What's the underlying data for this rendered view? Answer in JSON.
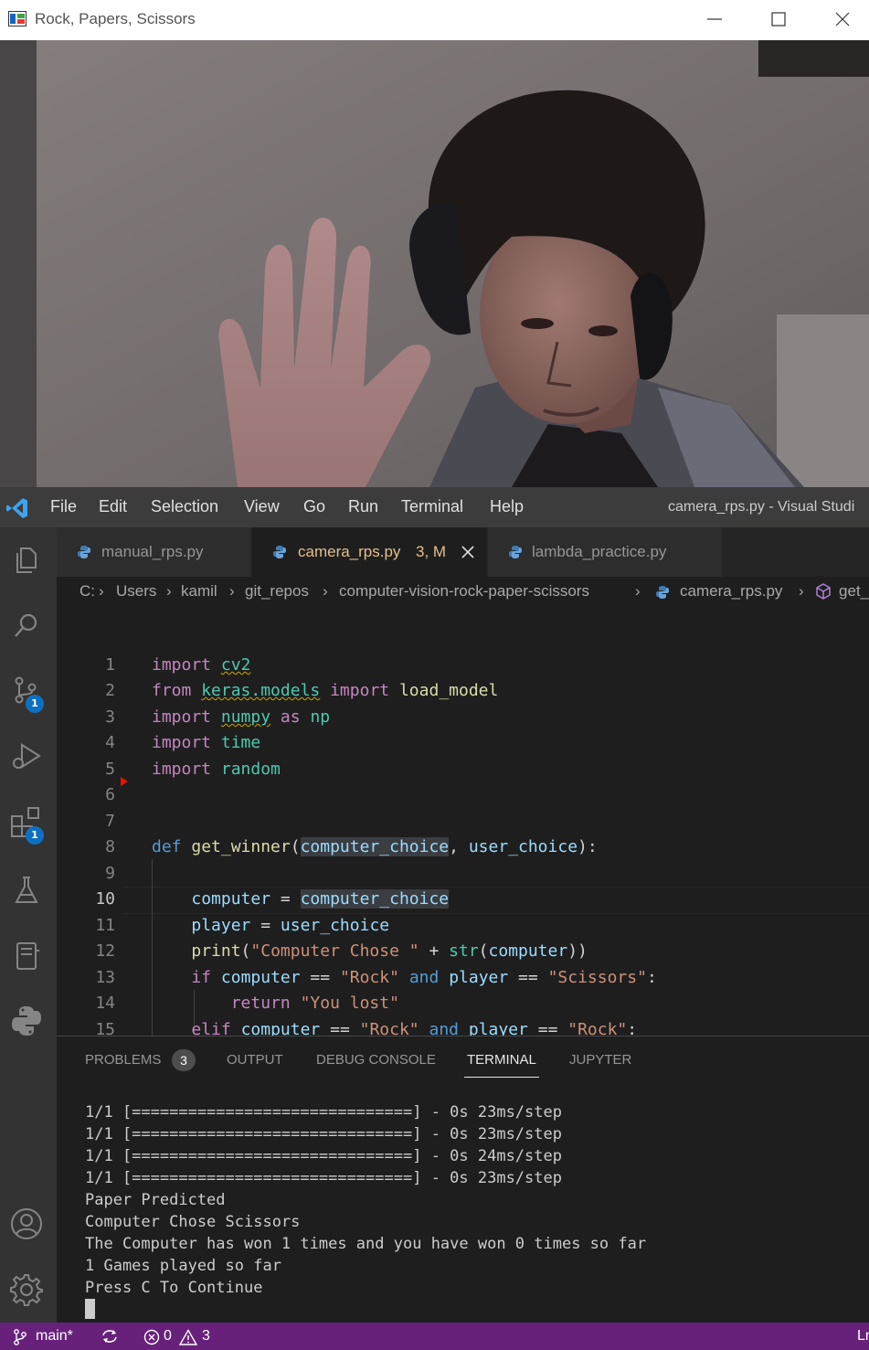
{
  "camera_window": {
    "title": "Rock, Papers, Scissors",
    "icons": {
      "app": "app-window-icon",
      "minimize": "minimize-icon",
      "maximize": "maximize-icon",
      "close": "close-icon"
    }
  },
  "vscode": {
    "menu": [
      "File",
      "Edit",
      "Selection",
      "View",
      "Go",
      "Run",
      "Terminal",
      "Help"
    ],
    "window_title": "camera_rps.py - Visual Studi",
    "activity_bar": {
      "icons": [
        "explorer-icon",
        "search-icon",
        "source-control-icon",
        "run-debug-icon",
        "extensions-icon",
        "testing-icon",
        "notebook-icon",
        "python-icon",
        "account-icon",
        "settings-gear-icon"
      ],
      "source_control_badge": "1",
      "extensions_badge": "1"
    },
    "tabs": [
      {
        "label": "manual_rps.py",
        "suffix": "",
        "active": false
      },
      {
        "label": "camera_rps.py",
        "suffix": "3, M",
        "active": true
      },
      {
        "label": "lambda_practice.py",
        "suffix": "",
        "active": false
      }
    ],
    "breadcrumb": [
      "C:",
      "Users",
      "kamil",
      "git_repos",
      "computer-vision-rock-paper-scissors",
      "camera_rps.py",
      "get_"
    ],
    "line_numbers": [
      "1",
      "2",
      "3",
      "4",
      "5",
      "6",
      "7",
      "8",
      "9",
      "10",
      "11",
      "12",
      "13",
      "14",
      "15"
    ],
    "current_line": "10",
    "panel": {
      "tabs": [
        "PROBLEMS",
        "OUTPUT",
        "DEBUG CONSOLE",
        "TERMINAL",
        "JUPYTER"
      ],
      "active_tab": "TERMINAL",
      "problems_count": "3",
      "terminal_lines": [
        "1/1 [==============================] - 0s 23ms/step",
        "1/1 [==============================] - 0s 23ms/step",
        "1/1 [==============================] - 0s 24ms/step",
        "1/1 [==============================] - 0s 23ms/step",
        "Paper Predicted",
        "Computer Chose Scissors",
        "The Computer has won 1 times and you have won 0 times so far",
        "1 Games played so far",
        "Press C To Continue"
      ]
    },
    "status_bar": {
      "branch": "main*",
      "errors": "0",
      "warnings": "3",
      "right_cut": "Ln"
    },
    "colors": {
      "status_bar": "#68217a",
      "editor_bg": "#1e1e1e",
      "accent": "#0e70c0"
    }
  }
}
